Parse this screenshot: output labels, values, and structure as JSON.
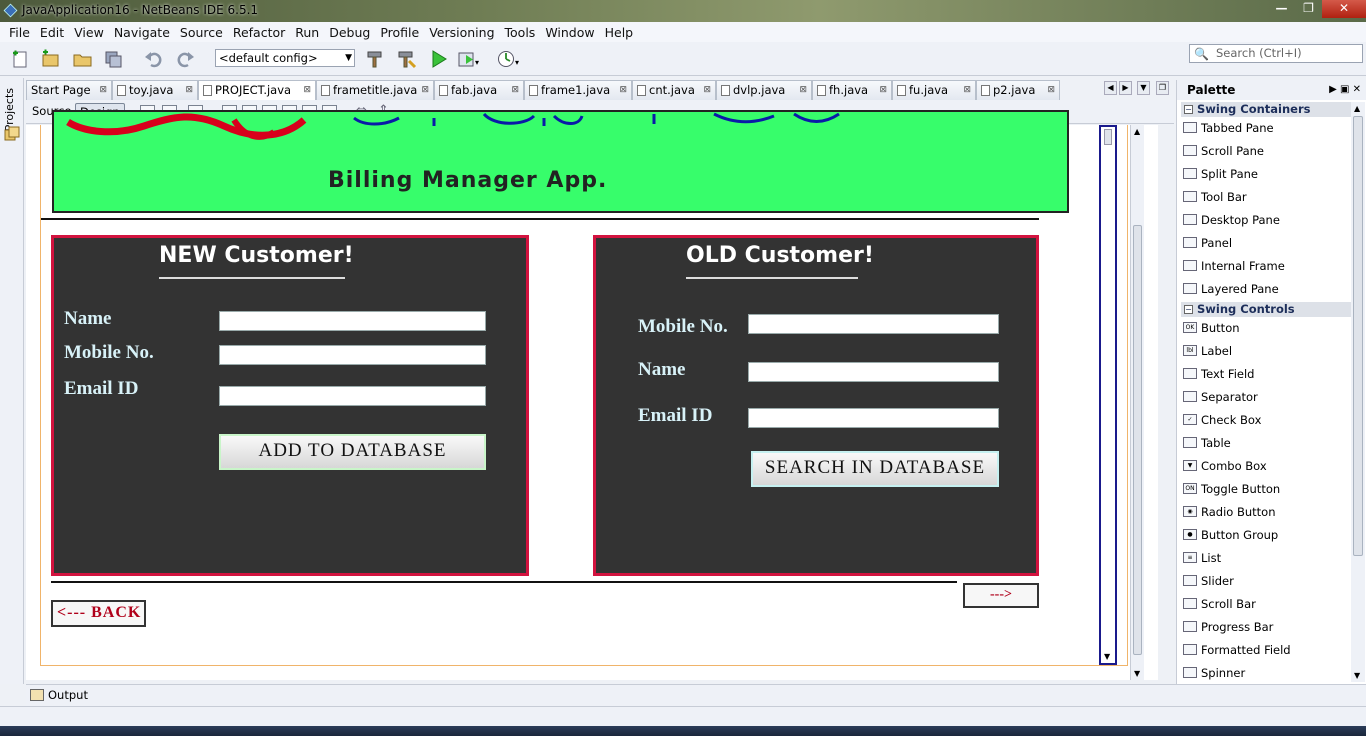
{
  "window": {
    "title": "JavaApplication16 - NetBeans IDE 6.5.1"
  },
  "menu": [
    "File",
    "Edit",
    "View",
    "Navigate",
    "Source",
    "Refactor",
    "Run",
    "Debug",
    "Profile",
    "Versioning",
    "Tools",
    "Window",
    "Help"
  ],
  "toolbar": {
    "config_value": "<default config>",
    "search_placeholder": "Search (Ctrl+I)"
  },
  "leftstrip": {
    "projects_label": "Projects"
  },
  "tabs": [
    "Start Page",
    "toy.java",
    "PROJECT.java",
    "frametitle.java",
    "fab.java",
    "frame1.java",
    "cnt.java",
    "dvlp.java",
    "fh.java",
    "fu.java",
    "p2.java"
  ],
  "active_tab": "PROJECT.java",
  "editor_mode": {
    "source_label": "Source",
    "design_label": "Design"
  },
  "form": {
    "banner_subtitle": "Billing Manager App.",
    "new_customer": {
      "title": "NEW Customer!",
      "name_label": "Name",
      "mobile_label": "Mobile No.",
      "email_label": "Email ID",
      "add_button": "ADD TO DATABASE"
    },
    "old_customer": {
      "title": "OLD Customer!",
      "mobile_label": "Mobile No.",
      "name_label": "Name",
      "email_label": "Email ID",
      "search_button": "SEARCH IN DATABASE"
    },
    "back_button": "<---  BACK",
    "next_button": "--->"
  },
  "palette": {
    "title": "Palette",
    "categories": [
      {
        "name": "Swing Containers",
        "items": [
          "Tabbed Pane",
          "Scroll Pane",
          "Split Pane",
          "Tool Bar",
          "Desktop Pane",
          "Panel",
          "Internal Frame",
          "Layered Pane"
        ]
      },
      {
        "name": "Swing Controls",
        "items": [
          "Button",
          "Label",
          "Text Field",
          "Separator",
          "Check Box",
          "Table",
          "Combo Box",
          "Toggle Button",
          "Radio Button",
          "Button Group",
          "List",
          "Slider",
          "Scroll Bar",
          "Progress Bar",
          "Formatted Field",
          "Spinner"
        ]
      }
    ]
  },
  "output": {
    "label": "Output"
  },
  "colors": {
    "banner_green": "#37fd6b",
    "panel_dark": "#333333",
    "panel_border": "#d2133f",
    "banner_red": "#d8001c",
    "banner_blue": "#0a1aa8"
  }
}
